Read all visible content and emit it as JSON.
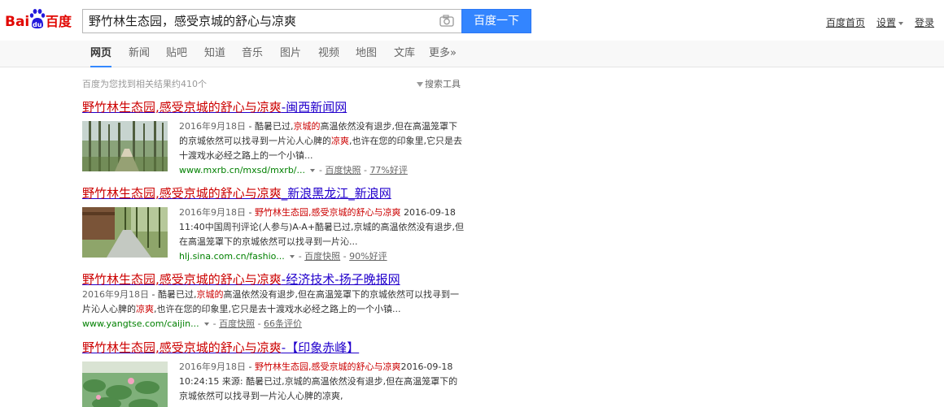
{
  "header": {
    "logo_text_left": "Bai",
    "logo_text_paw": "du",
    "logo_text_right": "百度",
    "search_query": "野竹林生态园，感受京城的舒心与凉爽",
    "search_button": "百度一下",
    "links": {
      "home": "百度首页",
      "settings": "设置",
      "login": "登录"
    }
  },
  "tabs": [
    {
      "label": "网页",
      "active": true
    },
    {
      "label": "新闻"
    },
    {
      "label": "贴吧"
    },
    {
      "label": "知道"
    },
    {
      "label": "音乐"
    },
    {
      "label": "图片"
    },
    {
      "label": "视频"
    },
    {
      "label": "地图"
    },
    {
      "label": "文库"
    },
    {
      "label": "更多»"
    }
  ],
  "result_count": "百度为您找到相关结果约410个",
  "search_tools": "搜索工具",
  "results": [
    {
      "title_hl": "野竹林生态园,感受京城的舒心与凉爽",
      "title_rest": "-闽西新闻网",
      "snippet_date": "2016年9月18日",
      "snippet_parts": [
        " - 酷暑已过,",
        "京城的",
        "高温依然没有退步,但在高温笼罩下的京城依然可以找寻到一片沁人心脾的",
        "凉爽",
        ",也许在您的印象里,它只是去十渡戏水必经之路上的一个小镇..."
      ],
      "url": "www.mxrb.cn/mxsd/mxrb/...",
      "snapshot": "百度快照",
      "rating": "77%好评"
    },
    {
      "title_hl": "野竹林生态园,感受京城的舒心与凉爽",
      "title_rest": "_新浪黑龙江_新浪网",
      "snippet_date": "2016年9月18日",
      "snippet_parts": [
        " - ",
        "野竹林生态园,感受京城的舒心与凉爽",
        " 2016-09-18 11:40中国周刊评论(人参与)A-A+酷暑已过,京城的高温依然没有退步,但在高温笼罩下的京城依然可以找寻到一片沁..."
      ],
      "url": "hlj.sina.com.cn/fashio...",
      "snapshot": "百度快照",
      "rating": "90%好评"
    },
    {
      "title_hl": "野竹林生态园,感受京城的舒心与凉爽",
      "title_rest": "-经济技术-扬子晚报网",
      "snippet_date": "2016年9月18日",
      "snippet_parts": [
        " - 酷暑已过,",
        "京城的",
        "高温依然没有退步,但在高温笼罩下的京城依然可以找寻到一片沁人心脾的",
        "凉爽",
        ",也许在您的印象里,它只是去十渡戏水必经之路上的一个小镇..."
      ],
      "url": "www.yangtse.com/caijin...",
      "snapshot": "百度快照",
      "rating": "66条评价"
    },
    {
      "title_hl": "野竹林生态园,感受京城的舒心与凉爽",
      "title_rest": "-【印象赤峰】",
      "snippet_date": "2016年9月18日",
      "snippet_parts": [
        " - ",
        "野竹林生态园,感受京城的舒心与凉爽",
        "2016-09-18 10:24:15 来源: 酷暑已过,京城的高温依然没有退步,但在高温笼罩下的京城依然可以找寻到一片沁人心脾的凉爽,"
      ]
    }
  ],
  "colors": {
    "brand_red": "#e10601",
    "brand_blue": "#2319dc",
    "search_button": "#3385ff",
    "link_blue": "#2200cc",
    "highlight_red": "#cc0000",
    "url_green": "#008000"
  }
}
